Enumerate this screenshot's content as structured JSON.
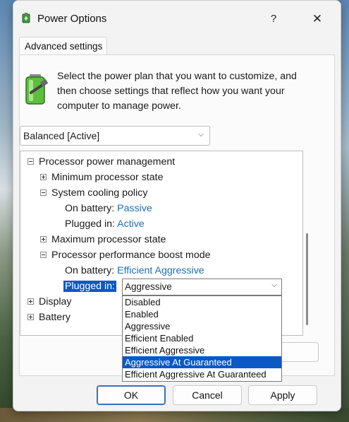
{
  "window": {
    "title": "Power Options",
    "help": "?",
    "close": "✕"
  },
  "tab": {
    "label": "Advanced settings"
  },
  "description": "Select the power plan that you want to customize, and then choose settings that reflect how you want your computer to manage power.",
  "plan": {
    "selected": "Balanced [Active]"
  },
  "tree": {
    "processor_power_management": "Processor power management",
    "min_state": "Minimum processor state",
    "cooling_policy": "System cooling policy",
    "cooling_on_battery_label": "On battery:",
    "cooling_on_battery_value": "Passive",
    "cooling_plugged_label": "Plugged in:",
    "cooling_plugged_value": "Active",
    "max_state": "Maximum processor state",
    "boost_mode": "Processor performance boost mode",
    "boost_on_battery_label": "On battery:",
    "boost_on_battery_value": "Efficient Aggressive",
    "boost_plugged_label": "Plugged in:",
    "display": "Display",
    "battery": "Battery"
  },
  "combo": {
    "selected": "Aggressive",
    "options": [
      "Disabled",
      "Enabled",
      "Aggressive",
      "Efficient Enabled",
      "Efficient Aggressive",
      "Aggressive At Guaranteed",
      "Efficient Aggressive At Guaranteed"
    ],
    "highlighted_index": 5
  },
  "buttons": {
    "ok": "OK",
    "cancel": "Cancel",
    "apply": "Apply"
  }
}
